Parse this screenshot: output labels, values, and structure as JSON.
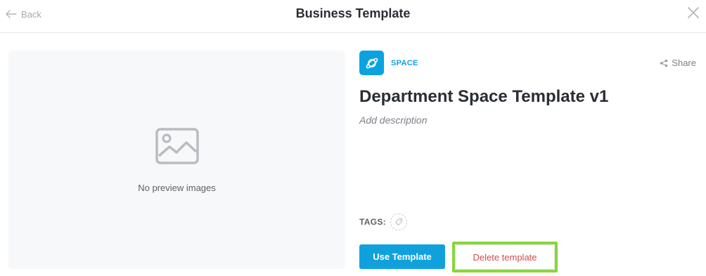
{
  "header": {
    "back_label": "Back",
    "title": "Business Template"
  },
  "preview": {
    "empty_text": "No preview images"
  },
  "template": {
    "type_label": "SPACE",
    "name": "Department Space Template v1",
    "description_placeholder": "Add description"
  },
  "actions": {
    "share_label": "Share",
    "use_label": "Use Template",
    "delete_label": "Delete template"
  },
  "tags": {
    "label": "TAGS:"
  },
  "colors": {
    "accent": "#10a1dd",
    "danger": "#d04b4b",
    "highlight": "#86d73b"
  }
}
